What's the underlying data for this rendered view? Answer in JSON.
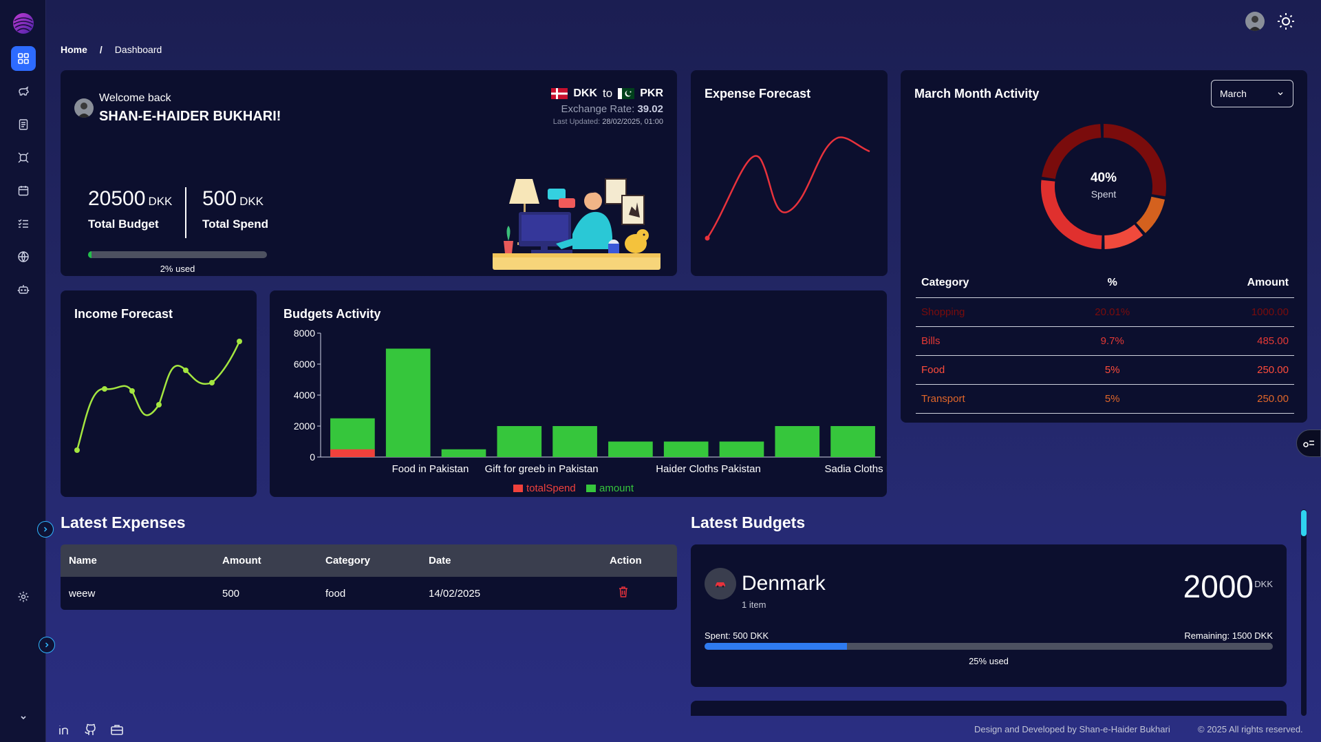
{
  "breadcrumb": {
    "home": "Home",
    "separator": "/",
    "current": "Dashboard"
  },
  "sidebar": {
    "items": [
      {
        "icon": "dashboard-grid-icon",
        "active": true
      },
      {
        "icon": "piggy-bank-icon"
      },
      {
        "icon": "document-icon"
      },
      {
        "icon": "bug-icon"
      },
      {
        "icon": "calendar-icon"
      },
      {
        "icon": "checklist-icon"
      },
      {
        "icon": "globe-icon"
      },
      {
        "icon": "bot-icon"
      }
    ],
    "settings_icon": "gear-icon"
  },
  "welcome": {
    "greeting": "Welcome back",
    "user_name": "SHAN-E-HAIDER BUKHARI!",
    "from_currency": "DKK",
    "to_word": "to",
    "to_currency": "PKR",
    "rate_label": "Exchange Rate:",
    "rate_value": "39.02",
    "updated_label": "Last Updated:",
    "updated_value": "28/02/2025, 01:00",
    "budget_value": "20500",
    "budget_unit": "DKK",
    "budget_label": "Total Budget",
    "spend_value": "500",
    "spend_unit": "DKK",
    "spend_label": "Total Spend",
    "used_fraction": 0.02,
    "used_label": "2% used"
  },
  "expense_forecast": {
    "title": "Expense Forecast",
    "line_color": "#e8323c"
  },
  "income_forecast": {
    "title": "Income Forecast",
    "line_color": "#a4e640"
  },
  "march": {
    "title": "March Month Activity",
    "select_value": "March",
    "donut_percent": "40%",
    "donut_label": "Spent",
    "table_headers": [
      "Category",
      "%",
      "Amount"
    ],
    "rows": [
      {
        "category": "Shopping",
        "percent": "20.01%",
        "amount": "1000.00",
        "color": "#7a0c0c"
      },
      {
        "category": "Bills",
        "percent": "9.7%",
        "amount": "485.00",
        "color": "#e53935"
      },
      {
        "category": "Food",
        "percent": "5%",
        "amount": "250.00",
        "color": "#ff4c3b"
      },
      {
        "category": "Transport",
        "percent": "5%",
        "amount": "250.00",
        "color": "#e0662a"
      }
    ]
  },
  "budgets_activity": {
    "title": "Budgets Activity"
  },
  "chart_data": {
    "type": "bar",
    "categories": [
      "",
      "Food in Pakistan",
      "",
      "Gift for greeb in Pakistan",
      "",
      "",
      "Haider Cloths Pakistan",
      "",
      "",
      "Sadia Cloths Pakistan"
    ],
    "series": [
      {
        "name": "totalSpend",
        "values": [
          500,
          0,
          0,
          0,
          0,
          0,
          0,
          0,
          0,
          0
        ],
        "color": "#f0413c"
      },
      {
        "name": "amount",
        "values": [
          2500,
          7000,
          500,
          2000,
          2000,
          1000,
          1000,
          1000,
          2000,
          2000
        ],
        "color": "#36c63c"
      }
    ],
    "stacked": true,
    "yticks": [
      "0",
      "2000",
      "4000",
      "6000",
      "8000"
    ],
    "ylim": [
      0,
      8000
    ],
    "legend": "bottom"
  },
  "latest_expenses": {
    "title": "Latest Expenses",
    "headers": [
      "Name",
      "Amount",
      "Category",
      "Date",
      "Action"
    ],
    "rows": [
      {
        "name": "weew",
        "amount": "500",
        "category": "food",
        "date": "14/02/2025"
      }
    ]
  },
  "latest_budgets": {
    "title": "Latest Budgets",
    "card": {
      "name": "Denmark",
      "items": "1 item",
      "amount": "2000",
      "unit": "DKK",
      "spent": "Spent: 500 DKK",
      "remaining": "Remaining: 1500 DKK",
      "used_fraction": 0.25,
      "used_label": "25% used"
    }
  },
  "footer": {
    "credit": "Design and Developed by Shan-e-Haider Bukhari",
    "copyright": "© 2025 All rights reserved.",
    "icons": [
      "linkedin-icon",
      "github-icon",
      "briefcase-icon"
    ]
  }
}
